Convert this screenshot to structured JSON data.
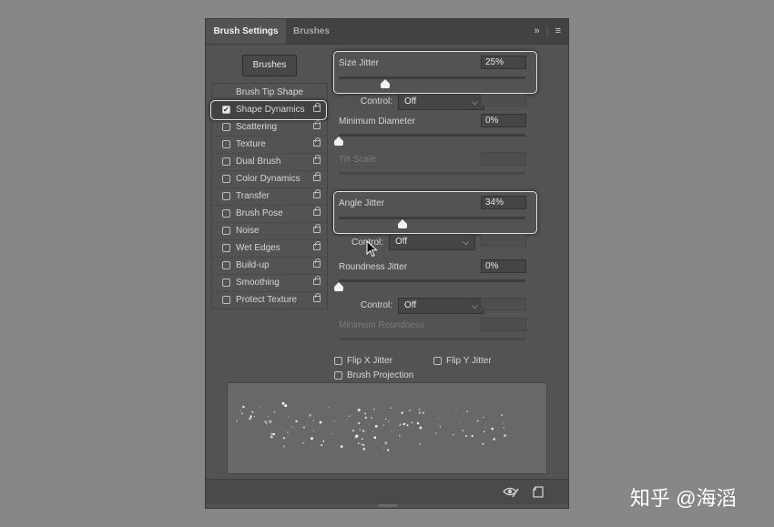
{
  "tabs": {
    "active": "Brush Settings",
    "other": "Brushes",
    "overflow_icon": "»",
    "menu_icon": "≡"
  },
  "brushes_button": "Brushes",
  "left_list": {
    "brush_tip_shape": "Brush Tip Shape",
    "items": [
      {
        "label": "Shape Dynamics",
        "checked": true
      },
      {
        "label": "Scattering",
        "checked": false
      },
      {
        "label": "Texture",
        "checked": false
      },
      {
        "label": "Dual Brush",
        "checked": false
      },
      {
        "label": "Color Dynamics",
        "checked": false
      },
      {
        "label": "Transfer",
        "checked": false
      },
      {
        "label": "Brush Pose",
        "checked": false
      },
      {
        "label": "Noise",
        "checked": false
      },
      {
        "label": "Wet Edges",
        "checked": false
      },
      {
        "label": "Build-up",
        "checked": false
      },
      {
        "label": "Smoothing",
        "checked": false
      },
      {
        "label": "Protect Texture",
        "checked": false
      }
    ]
  },
  "settings": {
    "size_jitter": {
      "label": "Size Jitter",
      "value": "25%",
      "level": 0.25
    },
    "control1": {
      "label": "Control:",
      "value": "Off"
    },
    "min_diameter": {
      "label": "Minimum Diameter",
      "value": "0%",
      "level": 0
    },
    "tilt_scale": {
      "label": "Tilt Scale"
    },
    "angle_jitter": {
      "label": "Angle Jitter",
      "value": "34%",
      "level": 0.34
    },
    "control2": {
      "label": "Control:",
      "value": "Off"
    },
    "roundness_jitter": {
      "label": "Roundness Jitter",
      "value": "0%",
      "level": 0
    },
    "control3": {
      "label": "Control:",
      "value": "Off"
    },
    "min_roundness": {
      "label": "Minimum Roundness"
    }
  },
  "checkboxes": {
    "flip_x": "Flip X Jitter",
    "flip_y": "Flip Y Jitter",
    "projection": "Brush Projection"
  },
  "watermark": "知乎 @海滔"
}
